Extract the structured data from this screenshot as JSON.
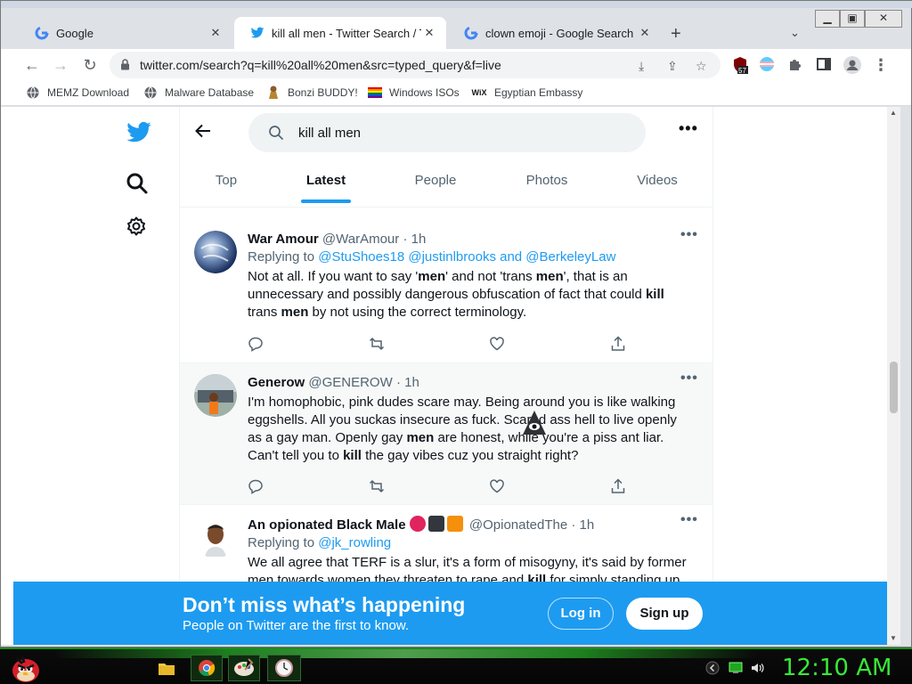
{
  "browser": {
    "tabs": [
      {
        "title": "Google",
        "icon": "google-icon",
        "active": false
      },
      {
        "title": "kill all men - Twitter Search / Twit",
        "icon": "twitter-icon",
        "active": true
      },
      {
        "title": "clown emoji - Google Search",
        "icon": "google-icon",
        "active": false
      }
    ],
    "url": "twitter.com/search?q=kill%20all%20men&src=typed_query&f=live",
    "extension_badge": "57",
    "bookmarks": [
      {
        "label": "MEMZ Download",
        "icon": "globe-icon"
      },
      {
        "label": "Malware Database",
        "icon": "globe-icon"
      },
      {
        "label": "Bonzi BUDDY!",
        "icon": "bonzi-icon"
      },
      {
        "label": "Windows ISOs",
        "icon": "rainbow-flag-icon"
      },
      {
        "label": "Egyptian Embassy",
        "icon": "wix-icon"
      }
    ],
    "wix_text": "WiX"
  },
  "twitter": {
    "search_query": "kill all men",
    "search_tabs": [
      "Top",
      "Latest",
      "People",
      "Photos",
      "Videos"
    ],
    "active_tab": "Latest",
    "tweets": [
      {
        "name": "War Amour",
        "handle": "@WarAmour",
        "time": "1h",
        "replying_label": "Replying to",
        "mentions": "@StuShoes18 @justinlbrooks and @BerkeleyLaw",
        "text_parts": [
          "Not at all.  If you want to say '",
          "men",
          "' and not 'trans ",
          "men",
          "', that is an unnecessary and possibly dangerous obfuscation of fact that could ",
          "kill",
          " trans ",
          "men",
          " by not using the correct terminology."
        ]
      },
      {
        "name": "Generow",
        "handle": "@GENEROW",
        "time": "1h",
        "text_parts": [
          "I'm homophobic, pink dudes scare may. Being around you is like walking eggshells. All you suckas insecure as fuck. Scared ass hell to live openly as a gay man. Openly gay ",
          "men",
          " are honest, while you're a piss ant liar. Can't tell you to ",
          "kill",
          " the gay vibes cuz you straight right?"
        ]
      },
      {
        "name": "An opionated Black Male",
        "handle": "@OpionatedThe",
        "time": "1h",
        "replying_label": "Replying to",
        "mentions": "@jk_rowling",
        "text_parts": [
          "We all agree that TERF is a slur, it's a form of misogyny, it's said by former ",
          "men towards women they threaten to rape and ",
          "kill",
          " for simply standing up"
        ]
      }
    ],
    "banner": {
      "headline": "Don’t miss what’s happening",
      "subtext": "People on Twitter are the first to know.",
      "login_label": "Log in",
      "signup_label": "Sign up"
    }
  },
  "taskbar": {
    "clock": "12:10 AM"
  },
  "colors": {
    "twitter_blue": "#1d9bf0",
    "clock_green": "#38e838"
  }
}
